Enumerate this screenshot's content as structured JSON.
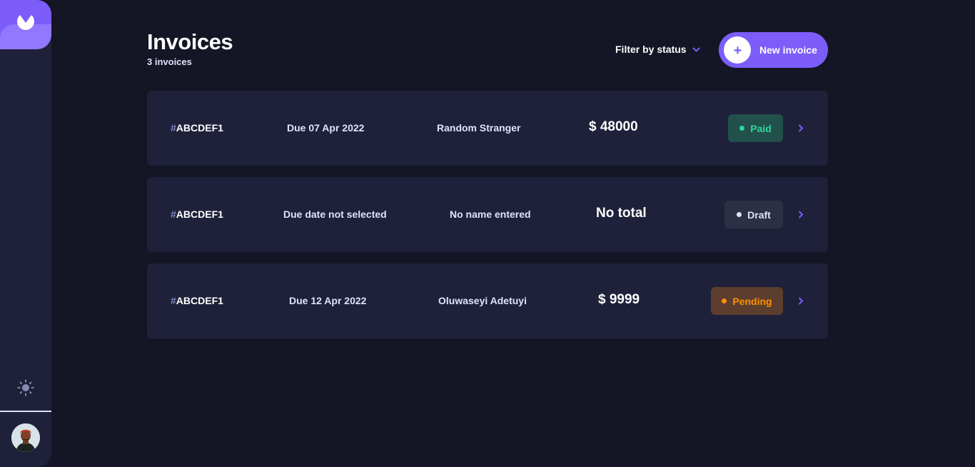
{
  "sidebar": {
    "logo_icon": "logo-icon",
    "theme_icon": "sun-icon",
    "avatar_icon": "avatar"
  },
  "header": {
    "title": "Invoices",
    "count": "3 invoices",
    "filter_label": "Filter by status",
    "new_button_label": "New invoice"
  },
  "invoices": [
    {
      "id_hash": "#",
      "id": "ABCDEF1",
      "due": "Due 07 Apr 2022",
      "client": "Random Stranger",
      "total": "$ 48000",
      "status": "Paid"
    },
    {
      "id_hash": "#",
      "id": "ABCDEF1",
      "due": "Due date not selected",
      "client": "No name entered",
      "total": "No total",
      "status": "Draft"
    },
    {
      "id_hash": "#",
      "id": "ABCDEF1",
      "due": "Due 12 Apr 2022",
      "client": "Oluwaseyi Adetuyi",
      "total": "$ 9999",
      "status": "Pending"
    }
  ],
  "colors": {
    "background": "#141625",
    "card": "#1e2139",
    "accent": "#7c5dfa",
    "paid": "#33d69f",
    "pending": "#ff8f00",
    "draft": "#dfe3fa"
  }
}
